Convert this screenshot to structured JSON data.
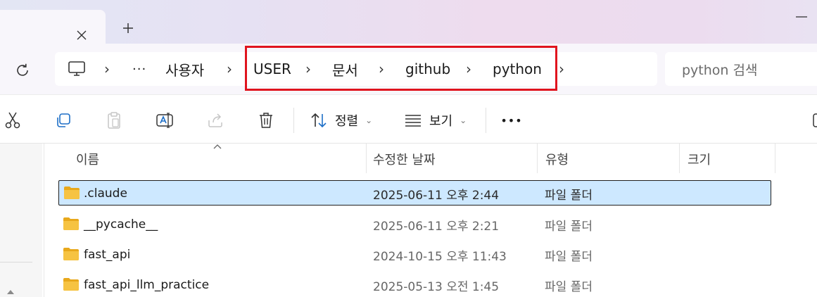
{
  "tabbar": {
    "close_glyph": "✕",
    "new_tab_glyph": "+",
    "minimize_glyph": "—"
  },
  "address": {
    "overflow": "···",
    "crumbs": [
      "사용자",
      "USER",
      "문서",
      "github",
      "python"
    ]
  },
  "search": {
    "placeholder": "python 검색"
  },
  "toolbar": {
    "sort_label": "정렬",
    "view_label": "보기",
    "more": "•••"
  },
  "columns": {
    "name": "이름",
    "date": "수정한 날짜",
    "type": "유형",
    "size": "크기"
  },
  "files": [
    {
      "name": ".claude",
      "date": "2025-06-11 오후 2:44",
      "type": "파일 폴더",
      "selected": true
    },
    {
      "name": "__pycache__",
      "date": "2025-06-11 오후 2:21",
      "type": "파일 폴더",
      "selected": false
    },
    {
      "name": "fast_api",
      "date": "2024-10-15 오후 11:43",
      "type": "파일 폴더",
      "selected": false
    },
    {
      "name": "fast_api_llm_practice",
      "date": "2025-05-13 오전 1:45",
      "type": "파일 폴더",
      "selected": false
    }
  ],
  "colors": {
    "selection_bg": "#cde8ff",
    "highlight_border": "#e0141e",
    "folder_yellow": "#f6c342"
  },
  "icons": {
    "toolbar": [
      "cut-icon",
      "copy-icon",
      "paste-icon",
      "rename-icon",
      "share-icon",
      "delete-icon",
      "sort-icon",
      "view-icon",
      "more-icon"
    ]
  }
}
